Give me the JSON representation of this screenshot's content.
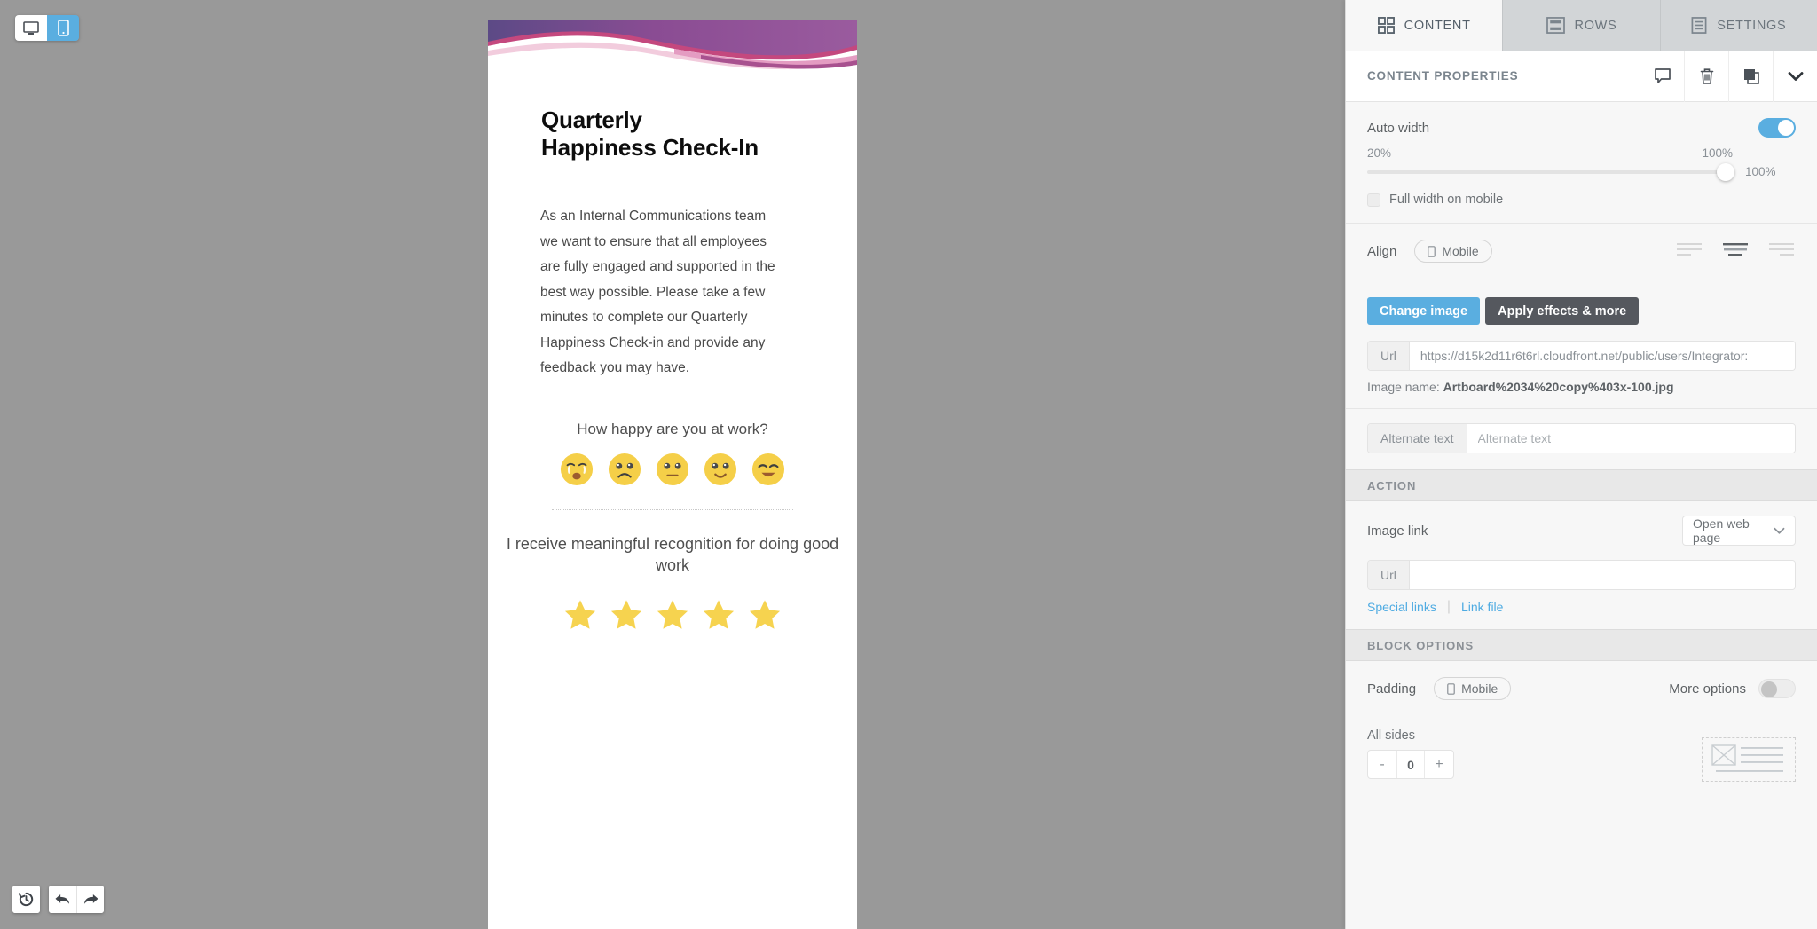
{
  "stage": {
    "device_toggle": {
      "desktop_label": "desktop-view",
      "mobile_label": "mobile-view",
      "active": "mobile",
      "accent": "#5aaee0"
    },
    "history": {
      "history_label": "history",
      "undo_label": "undo",
      "redo_label": "redo"
    },
    "background": "#999999"
  },
  "email": {
    "title": "Quarterly Happiness Check-In",
    "body": "As an Internal Communications team we want to ensure that all employees are fully engaged and supported in the best way possible. Please take a few minutes to complete our Quarterly Happiness Check-in and provide any feedback you may have.",
    "question_1": "How happy are you at work?",
    "emoji_scale": [
      "crying-face",
      "sad-face",
      "neutral-face",
      "slightly-smiling-face",
      "happy-face"
    ],
    "question_2": "I receive meaningful recognition for doing good work",
    "star_rating": {
      "count": 5,
      "filled": 5,
      "color": "#f6d34f"
    },
    "hero_colors": {
      "purple_dark": "#5c4a86",
      "purple": "#8a4c93",
      "magenta": "#c4487e",
      "pink": "#e49cc2",
      "pink_light": "#f2ccdd"
    }
  },
  "panel": {
    "tabs": [
      {
        "label": "CONTENT",
        "icon": "grid-icon",
        "active": true
      },
      {
        "label": "ROWS",
        "icon": "rows-icon",
        "active": false
      },
      {
        "label": "SETTINGS",
        "icon": "settings-icon",
        "active": false
      }
    ],
    "properties_header": {
      "title": "CONTENT PROPERTIES",
      "icons": [
        "comment-icon",
        "trash-icon",
        "duplicate-icon",
        "chevron-down-icon"
      ]
    },
    "auto_width": {
      "label": "Auto width",
      "enabled": true,
      "slider_min_label": "20%",
      "slider_max_label": "100%",
      "slider_value": "100%",
      "fill_percent": 100
    },
    "full_width_mobile": {
      "label": "Full width on mobile",
      "checked": false
    },
    "align": {
      "label": "Align",
      "device_pill": "Mobile",
      "options": [
        "align-left",
        "align-center",
        "align-right"
      ],
      "selected": "align-center"
    },
    "image_buttons": {
      "change_image": "Change image",
      "apply_effects": "Apply effects & more"
    },
    "image_url": {
      "addon": "Url",
      "value": "https://d15k2d11r6t6rl.cloudfront.net/public/users/Integrator:",
      "placeholder": ""
    },
    "image_name": {
      "label": "Image name:",
      "value": "Artboard%2034%20copy%403x-100.jpg"
    },
    "alternate_text": {
      "addon": "Alternate text",
      "placeholder": "Alternate text",
      "value": ""
    },
    "action": {
      "section_title": "ACTION",
      "image_link_label": "Image link",
      "image_link_value": "Open web page",
      "image_link_options": [
        "Open web page"
      ],
      "url_addon": "Url",
      "url_value": "",
      "special_links": "Special links",
      "link_file": "Link file"
    },
    "block_options": {
      "section_title": "BLOCK OPTIONS",
      "padding_label": "Padding",
      "padding_device_pill": "Mobile",
      "more_options_label": "More options",
      "more_options_enabled": false,
      "all_sides_label": "All sides",
      "padding_value": "0",
      "minus": "-",
      "plus": "+"
    }
  }
}
